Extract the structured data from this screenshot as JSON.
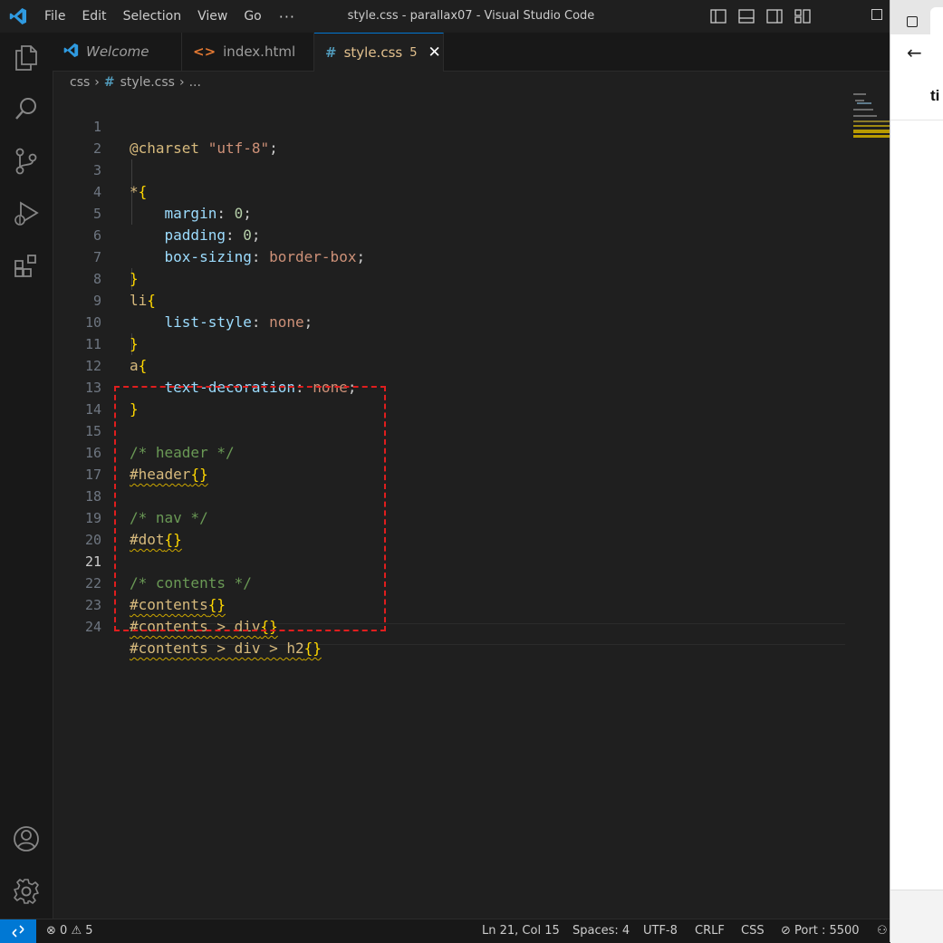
{
  "titlebar": {
    "menu": [
      "File",
      "Edit",
      "Selection",
      "View",
      "Go"
    ],
    "more": "···",
    "window_title": "style.css - parallax07 - Visual Studio Code"
  },
  "tabs": [
    {
      "label": "Welcome",
      "icon": "vscode-icon"
    },
    {
      "label": "index.html",
      "icon": "html-icon"
    },
    {
      "label": "style.css",
      "icon": "css-hash-icon",
      "badge": "5",
      "active": true
    }
  ],
  "breadcrumb": {
    "folder": "css",
    "file": "style.css",
    "more": "..."
  },
  "editor": {
    "current_line": 21,
    "lines": [
      {
        "n": "1"
      },
      {
        "n": "2"
      },
      {
        "n": "3"
      },
      {
        "n": "4"
      },
      {
        "n": "5"
      },
      {
        "n": "6"
      },
      {
        "n": "7"
      },
      {
        "n": "8"
      },
      {
        "n": "9"
      },
      {
        "n": "10"
      },
      {
        "n": "11"
      },
      {
        "n": "12"
      },
      {
        "n": "13"
      },
      {
        "n": "14"
      },
      {
        "n": "15"
      },
      {
        "n": "16"
      },
      {
        "n": "17"
      },
      {
        "n": "18"
      },
      {
        "n": "19"
      },
      {
        "n": "20"
      },
      {
        "n": "21"
      },
      {
        "n": "22"
      },
      {
        "n": "23"
      },
      {
        "n": "24"
      }
    ],
    "tokens": {
      "charset_kw": "@charset",
      "charset_val": "\"utf-8\"",
      "semi": ";",
      "star": "*",
      "open": "{",
      "close": "}",
      "empty": "{}",
      "margin": "margin",
      "padding": "padding",
      "box_sizing": "box-sizing",
      "list_style": "list-style",
      "text_decoration": "text-decoration",
      "colon": ": ",
      "zero": "0",
      "border_box": "border-box",
      "none": "none",
      "li": "li",
      "a": "a",
      "c_header": "/* header */",
      "sel_header": "#header",
      "c_nav": "/* nav */",
      "sel_dot": "#dot",
      "c_contents": "/* contents */",
      "sel_contents": "#contents",
      "sel_contents_div": "#contents > div",
      "sel_contents_div_h2": "#contents > div > h2"
    }
  },
  "browser": {
    "page_text": "ti"
  },
  "statusbar": {
    "errors": "0",
    "warnings": "5",
    "position": "Ln 21, Col 15",
    "spaces": "Spaces: 4",
    "encoding": "UTF-8",
    "eol": "CRLF",
    "language": "CSS",
    "port": "Port : 5500"
  },
  "colors": {
    "accent": "#0078d4",
    "highlight_box": "#e01e1e",
    "warning_squiggle": "#cca700"
  }
}
